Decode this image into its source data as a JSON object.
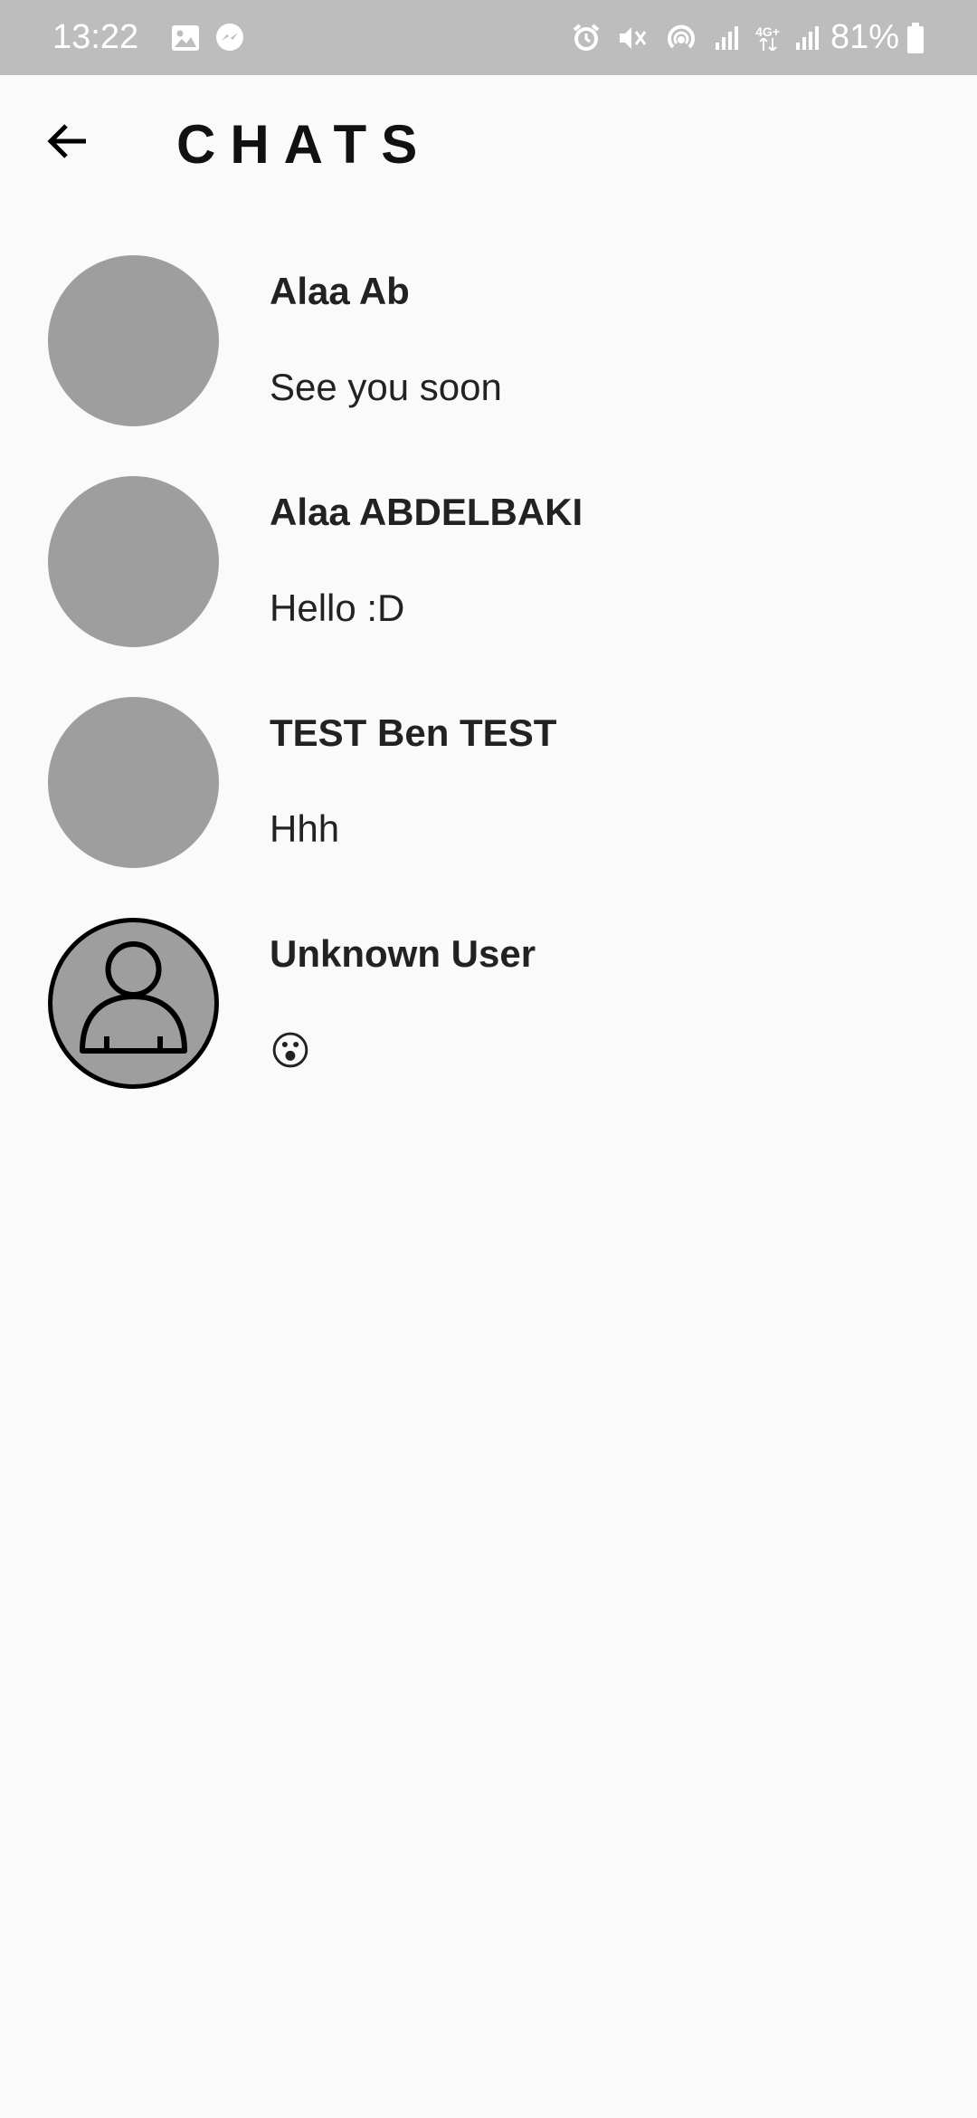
{
  "status_bar": {
    "time": "13:22",
    "battery": "81%",
    "icons_left": [
      "gallery-icon",
      "messenger-icon"
    ],
    "icons_right": [
      "alarm-icon",
      "mute-icon",
      "hotspot-icon",
      "signal-icon",
      "4g-icon",
      "signal-icon",
      "battery-icon"
    ],
    "network_label": "4G+"
  },
  "header": {
    "title": "CHATS",
    "back_icon": "arrow-left-icon"
  },
  "chats": [
    {
      "name": "Alaa Ab",
      "last_message": "See you soon",
      "avatar": "plain"
    },
    {
      "name": "Alaa ABDELBAKI",
      "last_message": "Hello :D",
      "avatar": "plain"
    },
    {
      "name": "TEST Ben TEST",
      "last_message": "Hhh",
      "avatar": "plain"
    },
    {
      "name": "Unknown User",
      "last_message": "😮",
      "avatar": "default-user-icon"
    }
  ],
  "colors": {
    "status_bar": "#bdbdbd",
    "background": "#fafafa",
    "avatar": "#9e9e9e",
    "text": "#222222"
  }
}
